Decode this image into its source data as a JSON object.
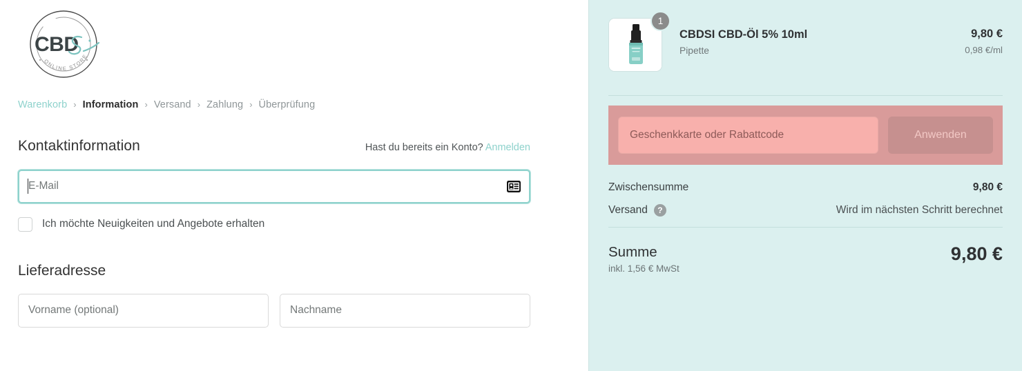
{
  "brand": {
    "logo_text": "CBD",
    "logo_script": "Si",
    "logo_caption": "· O N L I N E  S T O R E ·",
    "logo_name": "CBDSI Online Store"
  },
  "breadcrumb": {
    "items": [
      {
        "label": "Warenkorb",
        "state": "link"
      },
      {
        "label": "Information",
        "state": "current"
      },
      {
        "label": "Versand",
        "state": "muted"
      },
      {
        "label": "Zahlung",
        "state": "muted"
      },
      {
        "label": "Überprüfung",
        "state": "muted"
      }
    ],
    "separator": "›"
  },
  "contact": {
    "title": "Kontaktinformation",
    "account_question": "Hast du bereits ein Konto?",
    "login_label": "Anmelden",
    "email_placeholder": "E-Mail",
    "email_value": "",
    "email_icon": "contact-card-icon",
    "newsletter_label": "Ich möchte Neuigkeiten und Angebote erhalten",
    "newsletter_checked": false
  },
  "delivery": {
    "title": "Lieferadresse",
    "first_name_placeholder": "Vorname (optional)",
    "first_name_value": "",
    "last_name_placeholder": "Nachname",
    "last_name_value": ""
  },
  "order_summary": {
    "product": {
      "name": "CBDSI CBD-Öl 5% 10ml",
      "variant": "Pipette",
      "price": "9,80 €",
      "unit_price": "0,98 €/ml",
      "quantity": "1",
      "image_alt": "cbd-oil-dropper-bottle"
    },
    "discount": {
      "placeholder": "Geschenkkarte oder Rabattcode",
      "value": "",
      "apply_label": "Anwenden"
    },
    "subtotal_label": "Zwischensumme",
    "subtotal_value": "9,80 €",
    "shipping_label": "Versand",
    "shipping_help_icon": "question-mark-icon",
    "shipping_value": "Wird im nächsten Schritt berechnet",
    "total_label": "Summe",
    "total_tax_note": "inkl. 1,56 € MwSt",
    "total_value": "9,80 €"
  },
  "colors": {
    "accent_teal": "#8ed2cc",
    "sidebar_bg": "#dbf0ef",
    "discount_mask": "#d99b9a",
    "discount_input_bg": "#f8b0ac",
    "apply_button_bg": "#c6908f",
    "text_dark": "#2f3133",
    "text_muted": "#70787a"
  }
}
